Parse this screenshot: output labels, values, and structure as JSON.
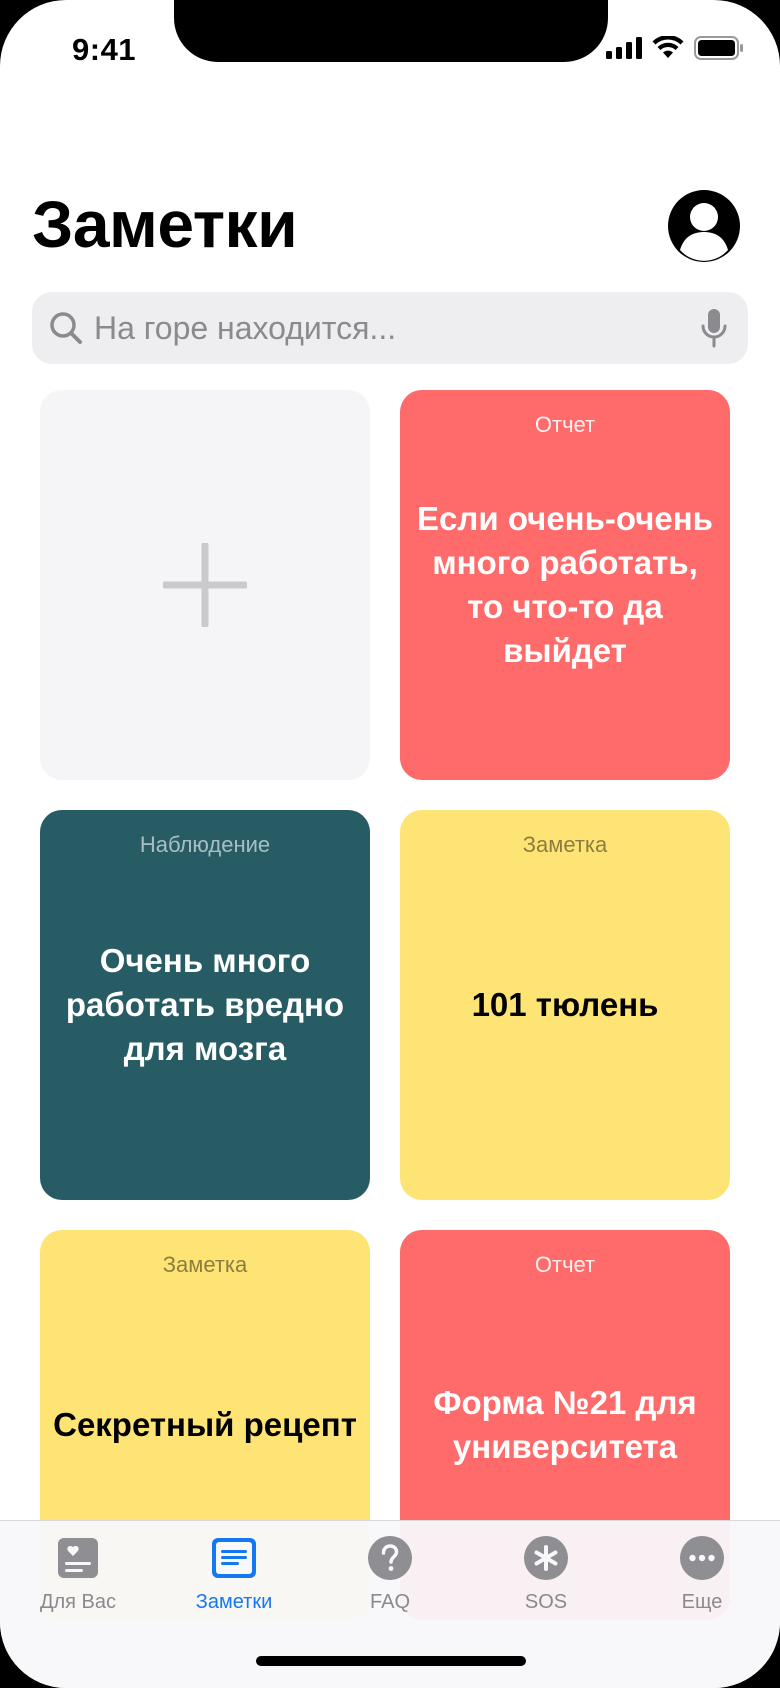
{
  "status_bar": {
    "time": "9:41"
  },
  "header": {
    "title": "Заметки"
  },
  "search": {
    "placeholder": "На горе находится..."
  },
  "cards": [
    {
      "type": "Отчет",
      "title": "Если очень-очень много работать, то что-то да выйдет",
      "color": "#ff6b6b"
    },
    {
      "type": "Наблюдение",
      "title": "Очень много работать вредно для мозга",
      "color": "#275c65"
    },
    {
      "type": "Заметка",
      "title": "101 тюлень",
      "color": "#fde475"
    },
    {
      "type": "Заметка",
      "title": "Секретный рецепт",
      "color": "#fde475"
    },
    {
      "type": "Отчет",
      "title": "Форма №21 для университета",
      "color": "#ff6b6b"
    }
  ],
  "tab_bar": {
    "active_color": "#1478f0",
    "items": [
      {
        "label": "Для Вас",
        "icon": "for-you-icon"
      },
      {
        "label": "Заметки",
        "icon": "notes-icon"
      },
      {
        "label": "FAQ",
        "icon": "question-icon"
      },
      {
        "label": "SOS",
        "icon": "asterisk-icon"
      },
      {
        "label": "Еще",
        "icon": "more-icon"
      }
    ]
  }
}
